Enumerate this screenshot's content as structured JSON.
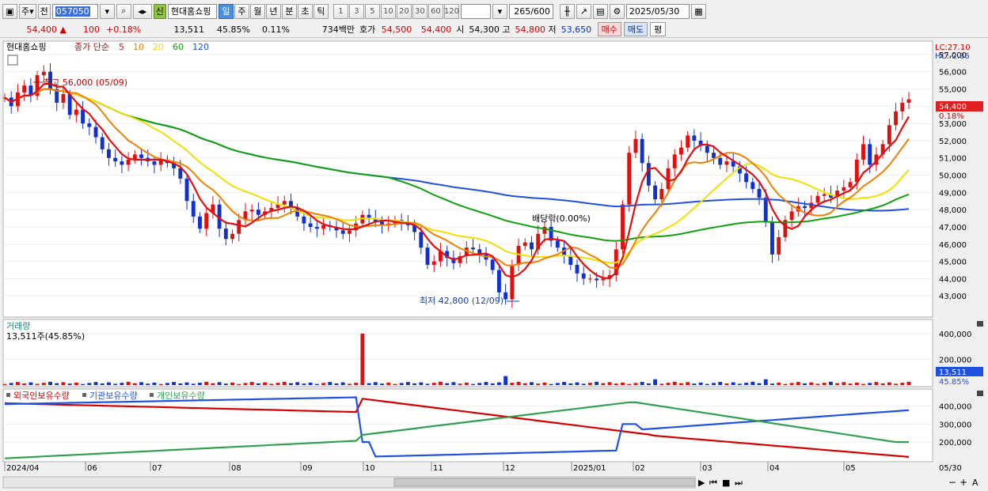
{
  "toolbar": {
    "tab_week": "주",
    "tab_prev": "전",
    "stock_code": "057050",
    "badge": "신",
    "stock_name": "현대홈쇼핑",
    "periods": [
      "일",
      "주",
      "월",
      "년",
      "분",
      "초",
      "틱"
    ],
    "active_period": "일",
    "numbers": [
      "1",
      "3",
      "5",
      "10",
      "20",
      "30",
      "60",
      "120"
    ],
    "count": "265",
    "count_total": "/600",
    "date": "2025/05/30"
  },
  "quote": {
    "price": "54,400",
    "change": "100",
    "change_pct": "+0.18%",
    "volume": "13,511",
    "vol_ratio": "45.85%",
    "turnover": "0.11%",
    "amount": "734백만",
    "ask_label": "호가",
    "ask": "54,500",
    "bid": "54,400",
    "open_label": "시",
    "open": "54,300",
    "high_label": "고",
    "high": "54,800",
    "low_label": "저",
    "low": "53,650",
    "buy": "매수",
    "sell": "매도",
    "eval": "평"
  },
  "price_panel": {
    "legend_stock": "현대홈쇼핑",
    "legend_ma": "종가 단순",
    "ma_labels": [
      "5",
      "10",
      "20",
      "60",
      "120"
    ],
    "ma_colors": [
      "#e01010",
      "#f08000",
      "#f0e000",
      "#10a010",
      "#2050e0"
    ],
    "lc": "LC:27.10",
    "hc": "HC:-2.86",
    "y_ticks": [
      "57,000",
      "56,000",
      "55,000",
      "54,000",
      "53,000",
      "52,000",
      "51,000",
      "50,000",
      "49,000",
      "48,000",
      "47,000",
      "46,000",
      "45,000",
      "44,000",
      "43,000"
    ],
    "last_price": "54,400",
    "last_pct": "0.18%",
    "high_note": "최고 56,000 (05/09)",
    "low_note": "최저 42,800 (12/09)",
    "dividend_note": "배당락(0.00%)"
  },
  "volume_panel": {
    "title": "거래량",
    "value": "13,511주(45.85%)",
    "y_ticks": [
      "400,000",
      "200,000"
    ],
    "last": "13,511",
    "last_pct": "45.85%"
  },
  "holdings_panel": {
    "legend": [
      "외국인보유수량",
      "기관보유수량",
      "개인보유수량"
    ],
    "colors": [
      "#d40000",
      "#2050e0",
      "#30a050"
    ],
    "y_ticks": [
      "400,000",
      "300,000",
      "200,000"
    ]
  },
  "x_axis": {
    "labels": [
      "2024/04",
      "06",
      "07",
      "08",
      "09",
      "10",
      "11",
      "12",
      "2025/01",
      "02",
      "03",
      "04",
      "05"
    ],
    "end_label": "05/30"
  },
  "chart_data": {
    "type": "line",
    "price_closes": [
      54500,
      54000,
      54800,
      55200,
      54600,
      55800,
      56000,
      55000,
      54200,
      54700,
      53500,
      53800,
      53000,
      52800,
      52200,
      51500,
      51000,
      50800,
      50600,
      50900,
      51200,
      51000,
      50800,
      50600,
      50900,
      50700,
      50400,
      49800,
      48500,
      47600,
      46900,
      47800,
      48300,
      46900,
      46300,
      46600,
      47400,
      47900,
      48000,
      47700,
      47900,
      48100,
      48300,
      48500,
      48100,
      47600,
      47200,
      47000,
      46900,
      47100,
      47000,
      46800,
      46600,
      46800,
      47200,
      47700,
      47500,
      47300,
      47100,
      47200,
      47400,
      47200,
      47100,
      46700,
      45800,
      44800,
      45000,
      45600,
      45200,
      44900,
      45300,
      45800,
      45700,
      45400,
      45100,
      44500,
      43200,
      42800,
      44800,
      45900,
      46100,
      45700,
      46600,
      47000,
      46200,
      45800,
      45300,
      44800,
      44300,
      44000,
      44000,
      43900,
      44000,
      44200,
      45700,
      48300,
      51300,
      52100,
      50700,
      49400,
      48600,
      49200,
      50400,
      51200,
      51600,
      52300,
      52000,
      51700,
      51300,
      51000,
      50600,
      50800,
      50500,
      50100,
      49600,
      49200,
      48700,
      47300,
      45400,
      46400,
      47400,
      47900,
      48200,
      48100,
      48400,
      48800,
      48900,
      48700,
      49100,
      49300,
      49600,
      50900,
      51800,
      50600,
      51200,
      51800,
      52900,
      53700,
      54200,
      54400
    ],
    "volume_y_range": [
      0,
      400000
    ],
    "holdings_y_range": [
      100000,
      450000
    ],
    "price_y_range": [
      42000,
      57500
    ]
  }
}
